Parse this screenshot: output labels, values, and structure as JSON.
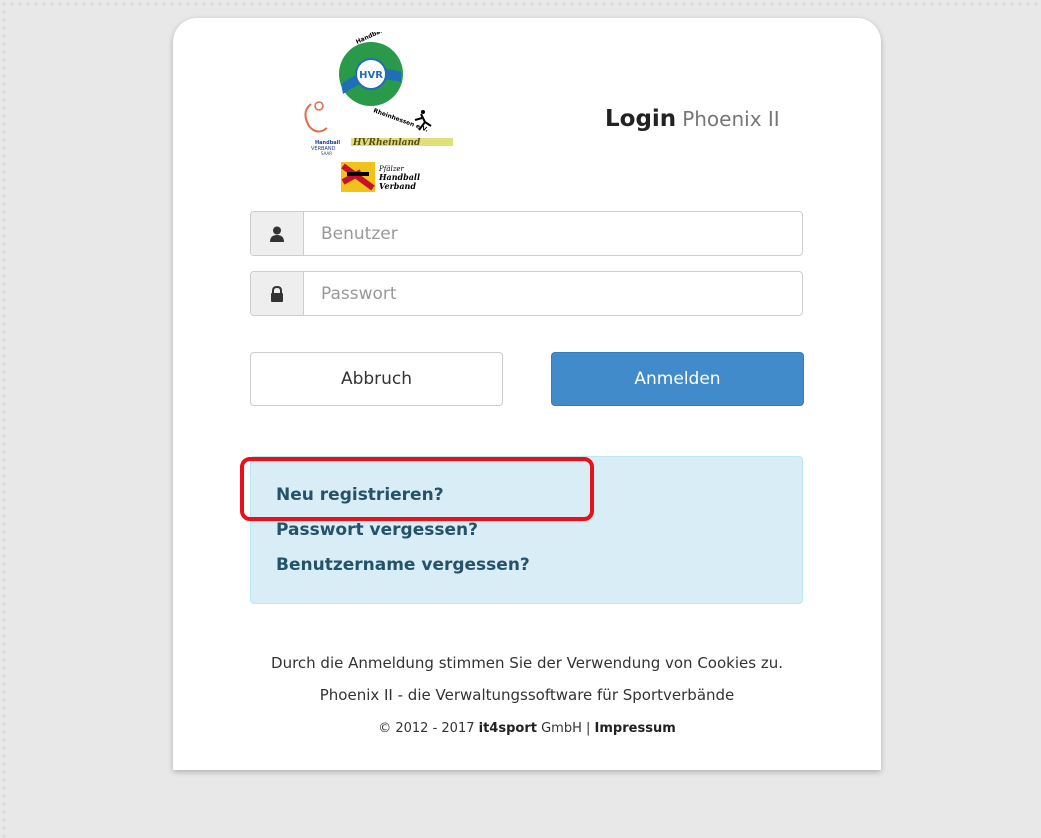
{
  "header": {
    "login_label": "Login",
    "app_name": "Phoenix II"
  },
  "logos": {
    "hvr_text": "Handball-Verband Rheinhessen e.V.",
    "hvr_mid": "HVR",
    "handball_verband_saar": "Handball VERBAND SAAR",
    "hvrheinland": "HVRheinland",
    "pfalzer_line1": "Pfälzer",
    "pfalzer_line2": "Handball",
    "pfalzer_line3": "Verband"
  },
  "form": {
    "username_placeholder": "Benutzer",
    "password_placeholder": "Passwort",
    "cancel_label": "Abbruch",
    "login_label": "Anmelden"
  },
  "links": {
    "register": "Neu registrieren?",
    "forgot_password": "Passwort vergessen?",
    "forgot_username": "Benutzername vergessen?"
  },
  "footer": {
    "cookies": "Durch die Anmeldung stimmen Sie der Verwendung von Cookies zu.",
    "tagline": "Phoenix II - die Verwaltungssoftware für Sportverbände",
    "copyright": "© 2012 - 2017",
    "company_bold": "it4sport",
    "company_suffix": "GmbH",
    "separator": "|",
    "impressum": "Impressum"
  },
  "colors": {
    "primary": "#428bca",
    "info_bg": "#d9edf7",
    "highlight": "#e8111a"
  }
}
